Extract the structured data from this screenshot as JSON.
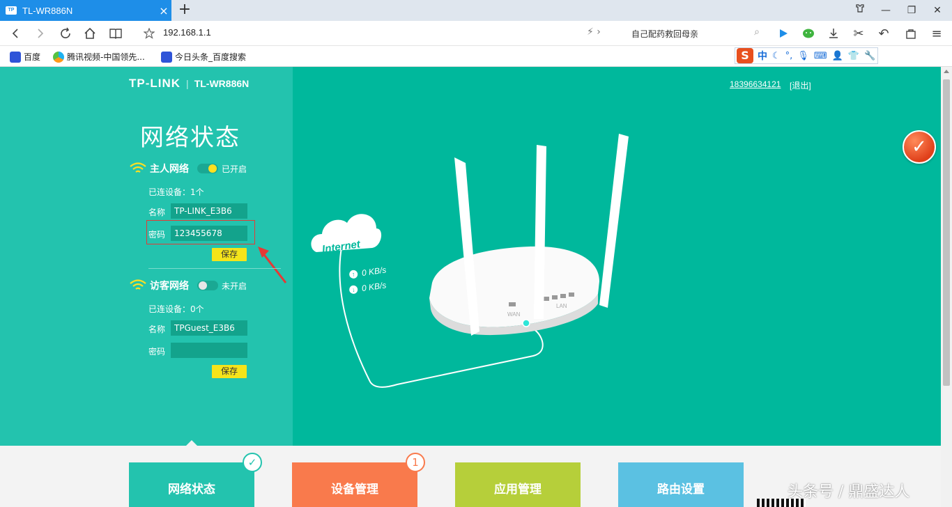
{
  "browser": {
    "tab_title": "TL-WR886N",
    "tab_favicon": "TP",
    "url": "192.168.1.1",
    "search_text": "自己配药救回母亲",
    "bookmarks": [
      "百度",
      "腾讯视频-中国领先...",
      "今日头条_百度搜索"
    ],
    "ime_label": "中"
  },
  "router": {
    "brand": "TP-LINK",
    "model": "TL-WR886N",
    "page_title": "网络状态",
    "user": "18396634121",
    "logout": "[退出]",
    "main_network": {
      "title": "主人网络",
      "status": "已开启",
      "enabled": true,
      "devices": "已连设备：1个",
      "name_label": "名称",
      "name_value": "TP-LINK_E3B6",
      "password_label": "密码",
      "password_value": "123455678",
      "save": "保存"
    },
    "guest_network": {
      "title": "访客网络",
      "status": "未开启",
      "enabled": false,
      "devices": "已连设备：0个",
      "name_label": "名称",
      "name_value": "TPGuest_E3B6",
      "password_label": "密码",
      "password_value": "",
      "save": "保存"
    },
    "diagram": {
      "internet_label": "Internet",
      "upload_rate": "0 KB/s",
      "download_rate": "0 KB/s",
      "wan_label": "WAN",
      "lan_label": "LAN"
    },
    "nav_tiles": [
      {
        "label": "网络状态",
        "color": "#23c3ae",
        "badge": "✓"
      },
      {
        "label": "设备管理",
        "color": "#f97a4c",
        "badge": "1"
      },
      {
        "label": "应用管理",
        "color": "#b6cf3a",
        "badge": ""
      },
      {
        "label": "路由设置",
        "color": "#5bc1e2",
        "badge": ""
      }
    ]
  },
  "watermark": "头条号 / 鼎盛达人",
  "colors": {
    "teal": "#00b89c",
    "panel": "#23c3ae",
    "save_yellow": "#f5e41a",
    "highlight_red": "#e53935",
    "tab_blue": "#1e8ee8"
  }
}
